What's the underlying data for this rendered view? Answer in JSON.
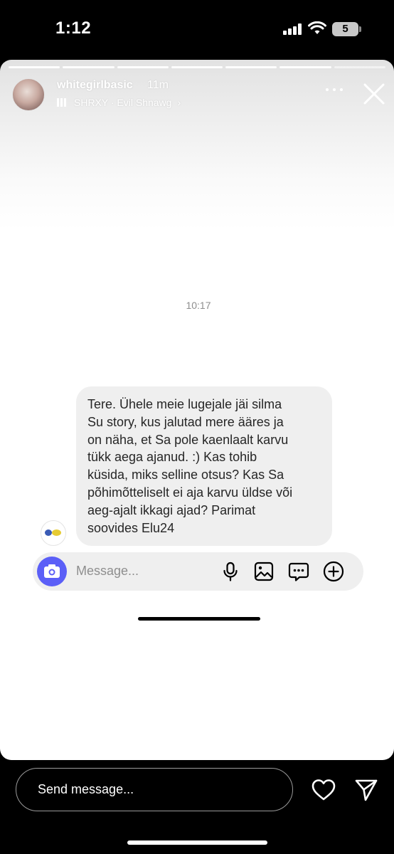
{
  "status_bar": {
    "time": "1:12",
    "battery": "5"
  },
  "story": {
    "username": "whitegirlbasic",
    "time_ago": "11m",
    "music": {
      "text": "SHRXY · Evil Shnawg",
      "chevron": "›"
    },
    "progress": {
      "segments_total": 7,
      "segments_viewed": 6
    }
  },
  "dm": {
    "timestamp": "10:17",
    "message_lines": [
      "Tere. Ühele meie lugejale jäi silma",
      "Su story, kus jalutad mere ääres ja",
      "on näha, et Sa pole kaenlaalt karvu",
      "tükk aega ajanud. :) Kas tohib",
      "küsida, miks selline otsus? Kas Sa",
      "põhimõtteliselt ei aja karvu üldse või",
      "aeg-ajalt ikkagi ajad? Parimat",
      "soovides Elu24"
    ],
    "input_placeholder": "Message...",
    "accent_color": "#5b5ff7"
  },
  "bottom_bar": {
    "send_placeholder": "Send message..."
  },
  "icons": {
    "more": "more-icon",
    "close": "close-icon",
    "camera": "camera-icon",
    "mic": "microphone-icon",
    "gallery": "gallery-icon",
    "sticker": "sticker-icon",
    "add": "add-icon",
    "heart": "heart-icon",
    "send": "paper-plane-icon"
  }
}
